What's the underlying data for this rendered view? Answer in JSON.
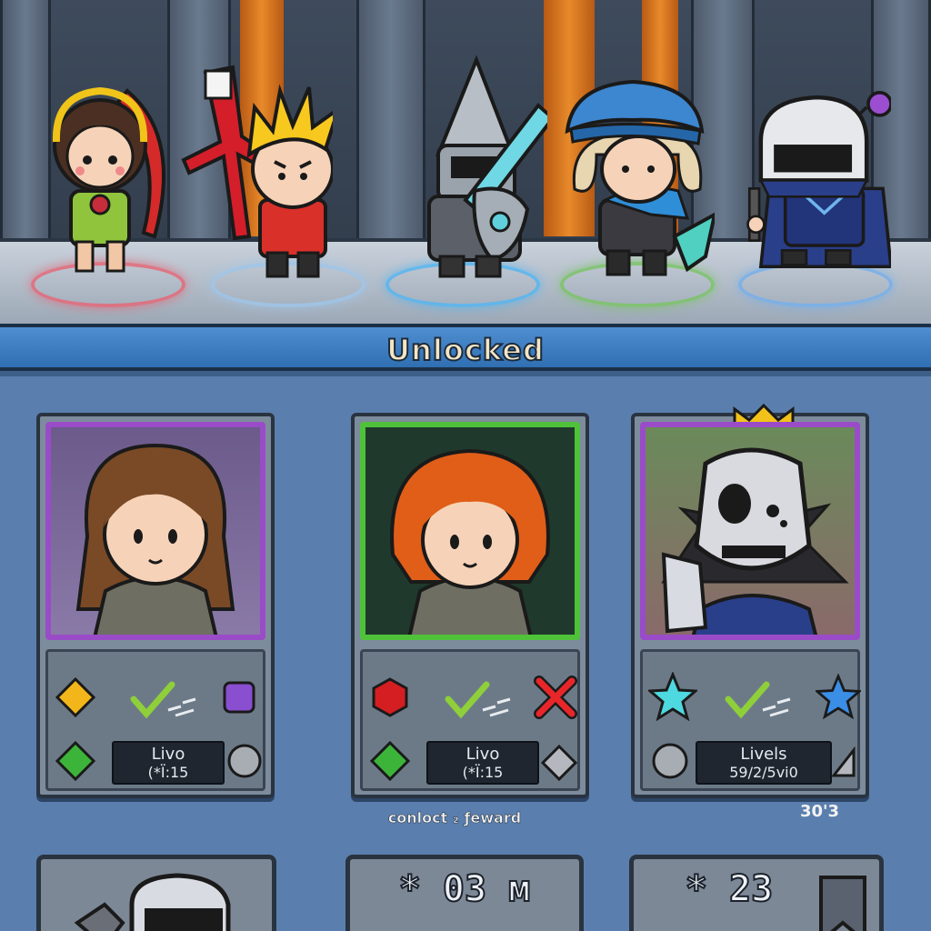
{
  "section": {
    "title": "Unlocked"
  },
  "heroes": [
    {
      "name": "Archer girl",
      "ring_color": "#e46a7a"
    },
    {
      "name": "Spiky blond fighter",
      "ring_color": "#9fc6ea"
    },
    {
      "name": "Knight",
      "ring_color": "#58b6f0"
    },
    {
      "name": "Blue cap rogue",
      "ring_color": "#7dc46a"
    },
    {
      "name": "Dark knight",
      "ring_color": "#78b0ea"
    }
  ],
  "cards": [
    {
      "frame_color": "#9a4cc8",
      "plate_line1": "Livo",
      "plate_line2": "(*Ї:15",
      "gems": [
        "yellow-diamond-icon",
        "purple-gem-icon",
        "green-diamond-icon",
        "silver-orb-icon"
      ]
    },
    {
      "frame_color": "#4fc23a",
      "plate_line1": "Livo",
      "plate_line2": "(*Ї:15",
      "gems": [
        "red-hexagon-icon",
        "red-x-icon",
        "green-diamond-icon",
        "silver-diamond-icon"
      ]
    },
    {
      "frame_color": "#9a4cc8",
      "plate_line1": "Livels",
      "plate_line2": "59/2/5vi0",
      "gems": [
        "cyan-star-icon",
        "blue-star-icon",
        "silver-orb-icon",
        "silver-triangle-icon"
      ]
    }
  ],
  "reward_text": "conloct ₂ ƒeward",
  "corner_count": "30'3",
  "bottom": [
    {
      "label": ""
    },
    {
      "label": "* 03 м"
    },
    {
      "label": "* 23"
    }
  ]
}
